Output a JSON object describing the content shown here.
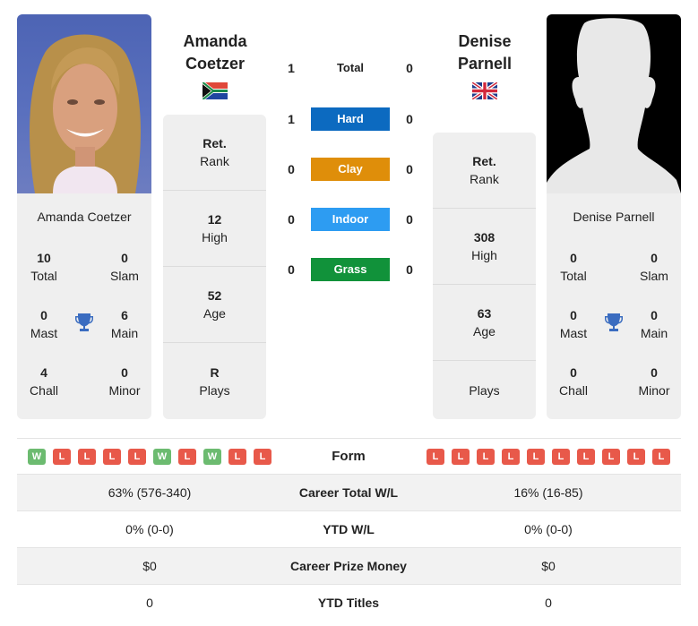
{
  "players": {
    "left": {
      "name_line1": "Amanda",
      "name_line2": "Coetzer",
      "card_name": "Amanda Coetzer",
      "country_flag": "south-africa-flag",
      "titles": {
        "total": {
          "value": "10",
          "label": "Total"
        },
        "slam": {
          "value": "0",
          "label": "Slam"
        },
        "mast": {
          "value": "0",
          "label": "Mast"
        },
        "main": {
          "value": "6",
          "label": "Main"
        },
        "chall": {
          "value": "4",
          "label": "Chall"
        },
        "minor": {
          "value": "0",
          "label": "Minor"
        }
      },
      "info": [
        {
          "value": "Ret.",
          "label": "Rank"
        },
        {
          "value": "12",
          "label": "High"
        },
        {
          "value": "52",
          "label": "Age"
        },
        {
          "value": "R",
          "label": "Plays"
        }
      ],
      "form": [
        "W",
        "L",
        "L",
        "L",
        "L",
        "W",
        "L",
        "W",
        "L",
        "L"
      ]
    },
    "right": {
      "name_line1": "Denise",
      "name_line2": "Parnell",
      "card_name": "Denise Parnell",
      "country_flag": "united-kingdom-flag",
      "titles": {
        "total": {
          "value": "0",
          "label": "Total"
        },
        "slam": {
          "value": "0",
          "label": "Slam"
        },
        "mast": {
          "value": "0",
          "label": "Mast"
        },
        "main": {
          "value": "0",
          "label": "Main"
        },
        "chall": {
          "value": "0",
          "label": "Chall"
        },
        "minor": {
          "value": "0",
          "label": "Minor"
        }
      },
      "info": [
        {
          "value": "Ret.",
          "label": "Rank"
        },
        {
          "value": "308",
          "label": "High"
        },
        {
          "value": "63",
          "label": "Age"
        },
        {
          "value": "",
          "label": "Plays"
        }
      ],
      "form": [
        "L",
        "L",
        "L",
        "L",
        "L",
        "L",
        "L",
        "L",
        "L",
        "L"
      ]
    }
  },
  "h2h": {
    "surfaces": [
      {
        "label": "Total",
        "left": "1",
        "right": "0",
        "color": ""
      },
      {
        "label": "Hard",
        "left": "1",
        "right": "0",
        "color": "#0c6ac0"
      },
      {
        "label": "Clay",
        "left": "0",
        "right": "0",
        "color": "#df8e0a"
      },
      {
        "label": "Indoor",
        "left": "0",
        "right": "0",
        "color": "#2d9cf2"
      },
      {
        "label": "Grass",
        "left": "0",
        "right": "0",
        "color": "#11923a"
      }
    ]
  },
  "form_label": "Form",
  "stats": [
    {
      "label": "Career Total W/L",
      "left": "63% (576-340)",
      "right": "16% (16-85)"
    },
    {
      "label": "YTD W/L",
      "left": "0% (0-0)",
      "right": "0% (0-0)"
    },
    {
      "label": "Career Prize Money",
      "left": "$0",
      "right": "$0"
    },
    {
      "label": "YTD Titles",
      "left": "0",
      "right": "0"
    }
  ]
}
